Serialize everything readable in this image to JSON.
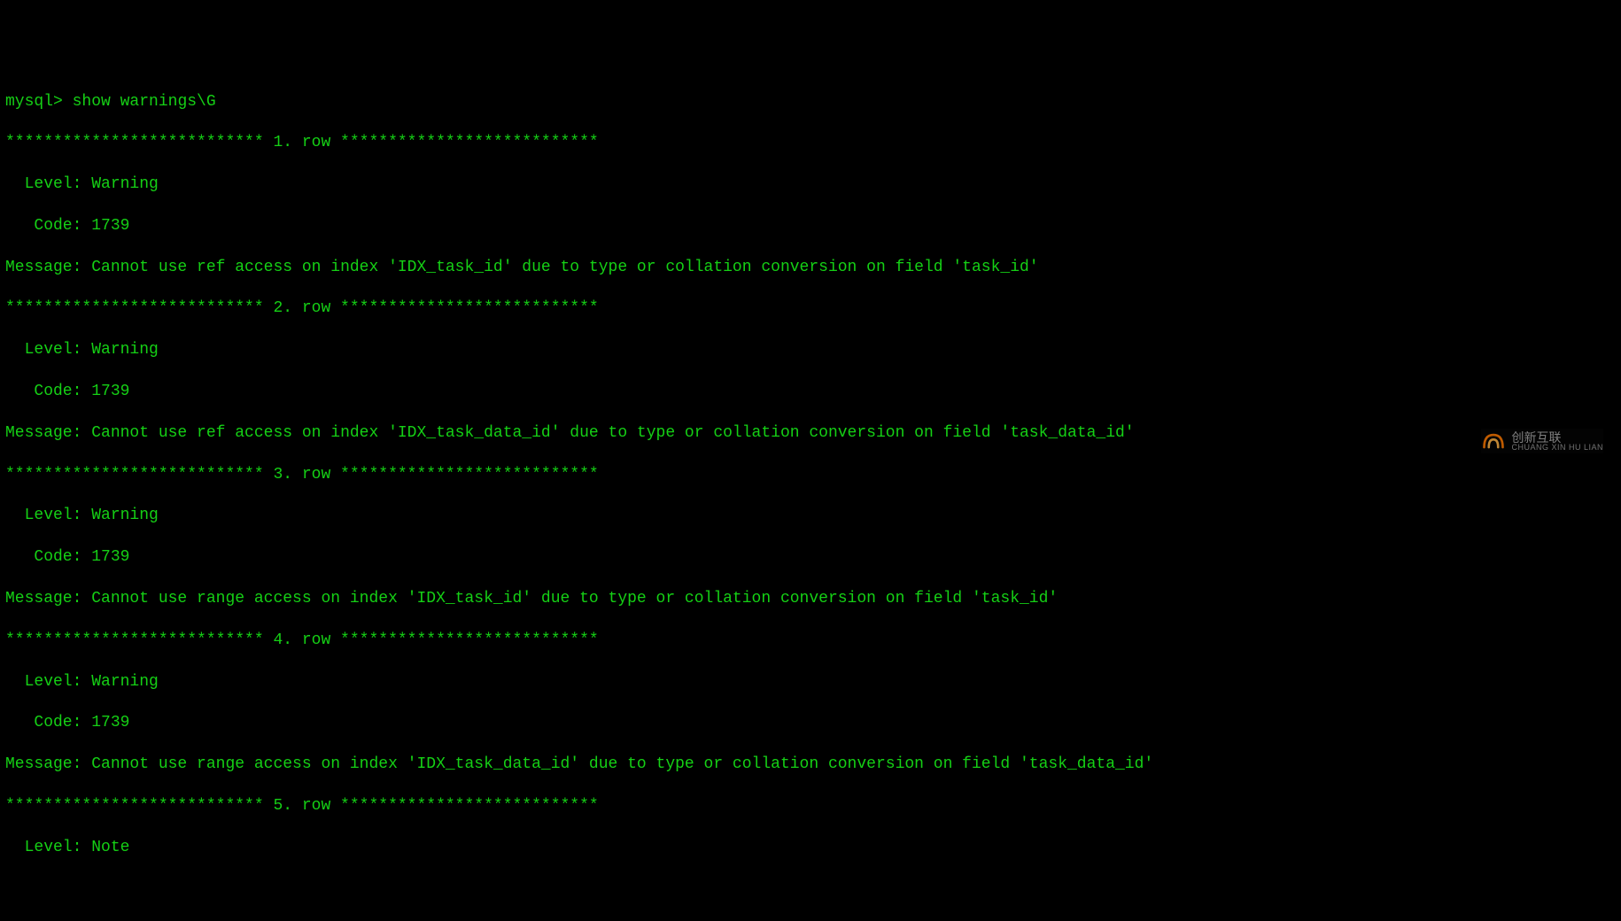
{
  "terminal": {
    "prompt": "mysql> ",
    "command": "show warnings\\G",
    "rows": [
      {
        "header": "*************************** 1. row ***************************",
        "level_label": "  Level: ",
        "level": "Warning",
        "code_label": "   Code: ",
        "code": "1739",
        "message_label": "Message: ",
        "message": "Cannot use ref access on index 'IDX_task_id' due to type or collation conversion on field 'task_id'"
      },
      {
        "header": "*************************** 2. row ***************************",
        "level_label": "  Level: ",
        "level": "Warning",
        "code_label": "   Code: ",
        "code": "1739",
        "message_label": "Message: ",
        "message": "Cannot use ref access on index 'IDX_task_data_id' due to type or collation conversion on field 'task_data_id'"
      },
      {
        "header": "*************************** 3. row ***************************",
        "level_label": "  Level: ",
        "level": "Warning",
        "code_label": "   Code: ",
        "code": "1739",
        "message_label": "Message: ",
        "message": "Cannot use range access on index 'IDX_task_id' due to type or collation conversion on field 'task_id'"
      },
      {
        "header": "*************************** 4. row ***************************",
        "level_label": "  Level: ",
        "level": "Warning",
        "code_label": "   Code: ",
        "code": "1739",
        "message_label": "Message: ",
        "message": "Cannot use range access on index 'IDX_task_data_id' due to type or collation conversion on field 'task_data_id'"
      },
      {
        "header": "*************************** 5. row ***************************",
        "level_label": "  Level: ",
        "level": "Note",
        "code_label": "",
        "code": "",
        "message_label": "",
        "message": ""
      }
    ]
  },
  "watermark": {
    "cn": "创新互联",
    "py": "CHUANG XIN HU LIAN"
  }
}
